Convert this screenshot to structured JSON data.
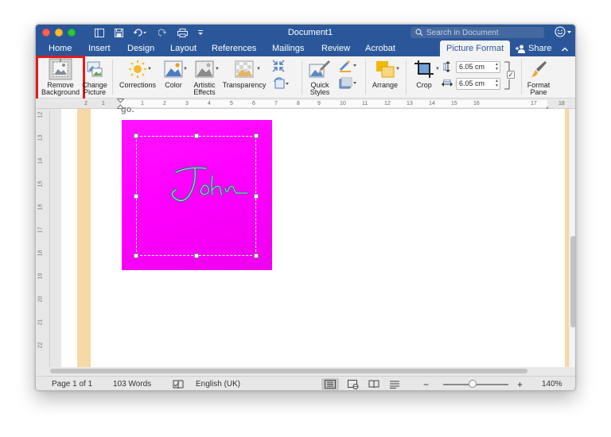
{
  "window": {
    "title": "Document1"
  },
  "search": {
    "placeholder": "Search in Document"
  },
  "tabs": [
    {
      "label": "Home"
    },
    {
      "label": "Insert"
    },
    {
      "label": "Design"
    },
    {
      "label": "Layout"
    },
    {
      "label": "References"
    },
    {
      "label": "Mailings"
    },
    {
      "label": "Review"
    },
    {
      "label": "Acrobat"
    },
    {
      "label": "Picture Format",
      "active": true
    }
  ],
  "share": {
    "label": "Share"
  },
  "ribbon": {
    "remove_background": {
      "line1": "Remove",
      "line2": "Background"
    },
    "change_picture": {
      "line1": "Change",
      "line2": "Picture"
    },
    "corrections": "Corrections",
    "color": "Color",
    "artistic_effects": {
      "line1": "Artistic",
      "line2": "Effects"
    },
    "transparency": "Transparency",
    "quick_styles": {
      "line1": "Quick",
      "line2": "Styles"
    },
    "arrange": "Arrange",
    "crop": "Crop",
    "height_value": "6.05 cm",
    "width_value": "6.05 cm",
    "format_pane": {
      "line1": "Format",
      "line2": "Pane"
    }
  },
  "ruler": {
    "top_numbers": [
      "2",
      "1",
      "1",
      "2",
      "3",
      "4",
      "5",
      "6",
      "7",
      "8",
      "9",
      "10",
      "11",
      "12",
      "13",
      "14",
      "15",
      "16",
      "17",
      "18"
    ],
    "left_numbers": [
      "12",
      "13",
      "14",
      "15",
      "16",
      "17",
      "18",
      "19",
      "20",
      "21",
      "22"
    ]
  },
  "document": {
    "peek_text": "go.",
    "signature_text": "John",
    "picture_color": "#ff00ff",
    "margin_color": "#f7d8a7"
  },
  "status": {
    "page": "Page 1 of 1",
    "words": "103 Words",
    "language": "English (UK)",
    "zoom_minus": "−",
    "zoom_plus": "+",
    "zoom_level": "140%",
    "zoom_fraction": 0.45
  },
  "colors": {
    "accent": "#2b579a",
    "highlight": "#e31b1b"
  }
}
